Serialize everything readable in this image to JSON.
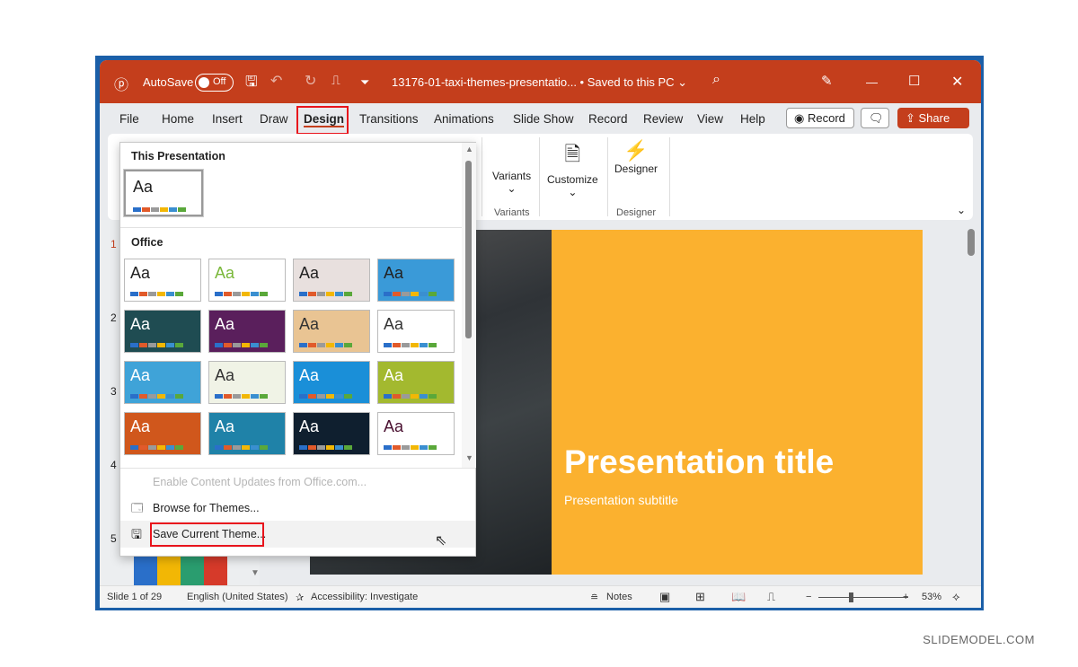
{
  "titlebar": {
    "autosave_label": "AutoSave",
    "autosave_state": "Off",
    "filename": "13176-01-taxi-themes-presentatio... • Saved to this PC ⌄",
    "accent": "#C43E1C"
  },
  "tabs": [
    "File",
    "Home",
    "Insert",
    "Draw",
    "Design",
    "Transitions",
    "Animations",
    "Slide Show",
    "Record",
    "Review",
    "View",
    "Help"
  ],
  "active_tab": "Design",
  "buttons": {
    "record": "Record",
    "share": "Share"
  },
  "ribbon": {
    "variants": "Variants",
    "customize": "Customize",
    "designer": "Designer",
    "group_variants": "Variants",
    "group_designer": "Designer"
  },
  "dropdown": {
    "this_presentation": "This Presentation",
    "office": "Office",
    "menu": {
      "enable_updates": "Enable Content Updates from Office.com...",
      "browse": "Browse for Themes...",
      "save": "Save Current Theme..."
    },
    "themes": [
      {
        "bg": "#ffffff",
        "fg": "#222"
      },
      {
        "bg": "#ffffff",
        "fg": "#7ab83a"
      },
      {
        "bg": "#e8e0de",
        "fg": "#222"
      },
      {
        "bg": "#3a9ad8",
        "fg": "#222"
      },
      {
        "bg": "#1f4c52",
        "fg": "#fff"
      },
      {
        "bg": "#5a1f5c",
        "fg": "#fff"
      },
      {
        "bg": "#e9c493",
        "fg": "#333"
      },
      {
        "bg": "#ffffff",
        "fg": "#333"
      },
      {
        "bg": "#3fa3d8",
        "fg": "#fff"
      },
      {
        "bg": "#f0f3e6",
        "fg": "#333"
      },
      {
        "bg": "#1a8fd8",
        "fg": "#fff"
      },
      {
        "bg": "#a3b92f",
        "fg": "#fff"
      },
      {
        "bg": "#d0571c",
        "fg": "#fff"
      },
      {
        "bg": "#1f82a8",
        "fg": "#fff"
      },
      {
        "bg": "#0f1f2f",
        "fg": "#fff"
      },
      {
        "bg": "#ffffff",
        "fg": "#4a1030"
      }
    ],
    "swatch": [
      "#2a6fc9",
      "#e15a2a",
      "#9a9a9a",
      "#f2b705",
      "#3a8fd0",
      "#5aa83a"
    ]
  },
  "thumb_aa": "Aa",
  "slide_numbers": [
    "1",
    "2",
    "3",
    "4",
    "5"
  ],
  "slide": {
    "title": "Presentation title",
    "subtitle": "Presentation subtitle",
    "bg": "#FBB12F"
  },
  "status": {
    "slide": "Slide 1 of 29",
    "language": "English (United States)",
    "accessibility": "Accessibility: Investigate",
    "notes": "Notes",
    "zoom": "53%",
    "zoom_level_percent": 53
  },
  "watermark": "SLIDEMODEL.COM"
}
